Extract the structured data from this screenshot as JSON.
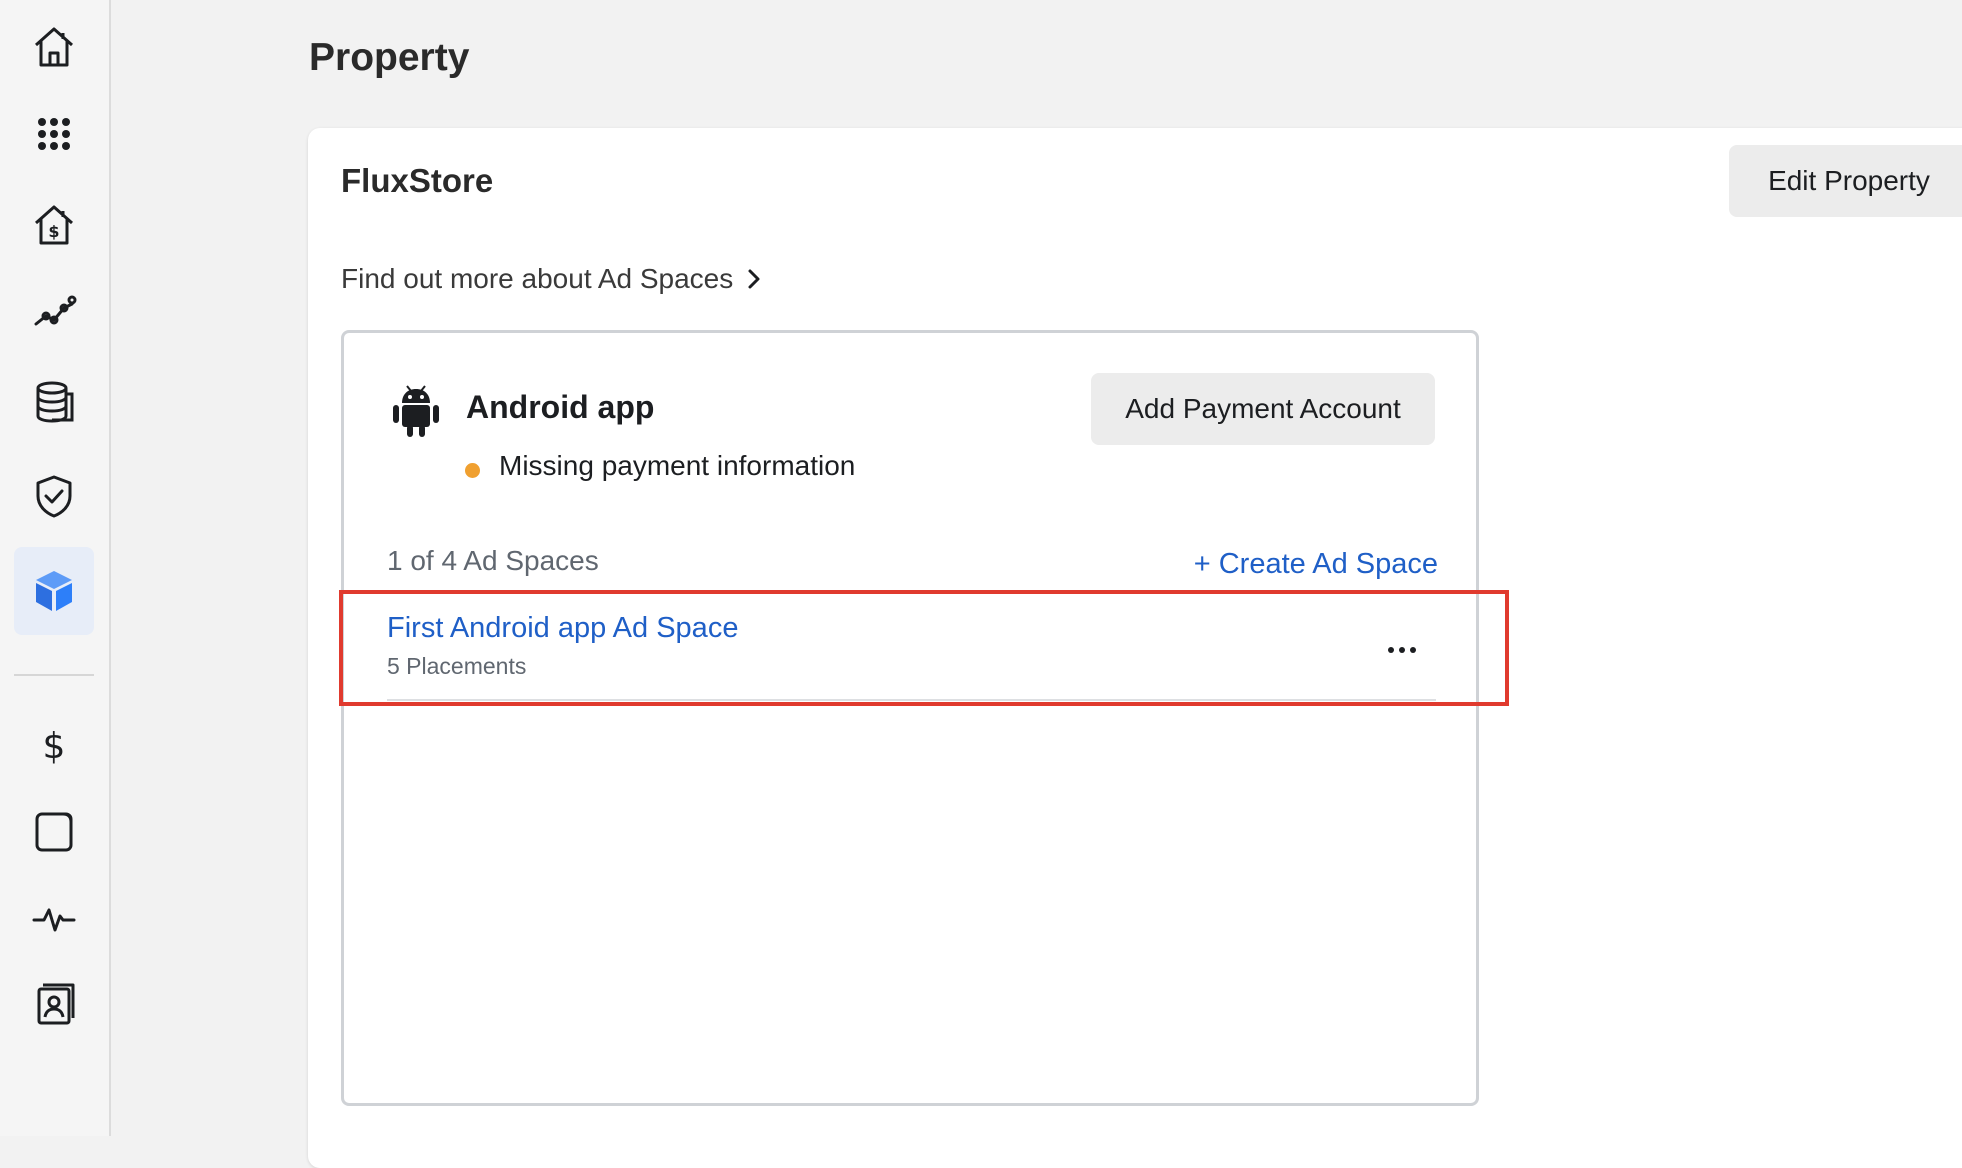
{
  "sidebar": {
    "items": [
      {
        "icon": "home-icon"
      },
      {
        "icon": "apps-grid-icon"
      },
      {
        "icon": "monetization-house-icon"
      },
      {
        "icon": "analytics-icon"
      },
      {
        "icon": "database-icon"
      },
      {
        "icon": "shield-check-icon"
      },
      {
        "icon": "cube-icon",
        "active": true
      },
      {
        "icon": "dollar-icon"
      },
      {
        "icon": "tablet-icon"
      },
      {
        "icon": "activity-icon"
      },
      {
        "icon": "contact-card-icon"
      }
    ]
  },
  "page": {
    "title": "Property"
  },
  "property": {
    "name": "FluxStore",
    "edit_label": "Edit Property",
    "learn_more": "Find out more about Ad Spaces"
  },
  "app": {
    "name": "Android app",
    "status": "Missing payment information",
    "status_color": "#f0a030",
    "add_payment_label": "Add Payment Account",
    "ad_spaces_count": "1 of 4 Ad Spaces",
    "create_label": "+ Create Ad Space",
    "ad_spaces": [
      {
        "name": "First Android app Ad Space",
        "placements": "5 Placements"
      }
    ]
  },
  "colors": {
    "link": "#1f5fc7",
    "highlight": "#e03a2e",
    "active_nav": "#e7edf8",
    "accent": "#2d7ff9"
  }
}
